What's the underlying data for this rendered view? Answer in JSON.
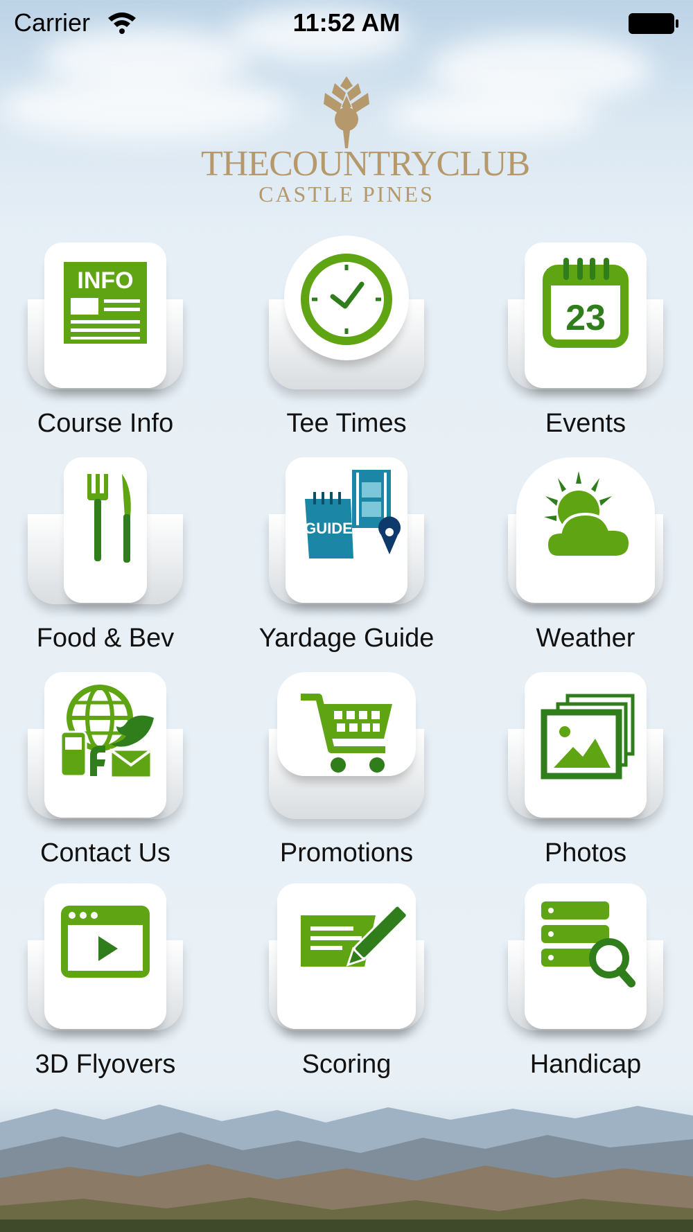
{
  "status_bar": {
    "carrier": "Carrier",
    "time": "11:52 AM"
  },
  "logo": {
    "title": "THECOUNTRYCLUB",
    "subtitle": "CASTLE PINES"
  },
  "colors": {
    "accent_green": "#5ea413",
    "dark_green": "#2f7d1b",
    "gold": "#b5996c",
    "guide_blue": "#1b86a6"
  },
  "tiles": [
    {
      "label": "Course Info",
      "icon": "info-newspaper-icon"
    },
    {
      "label": "Tee Times",
      "icon": "clock-icon"
    },
    {
      "label": "Events",
      "icon": "calendar-icon",
      "calendar_day": "23"
    },
    {
      "label": "Food & Bev",
      "icon": "fork-knife-icon"
    },
    {
      "label": "Yardage Guide",
      "icon": "guide-map-icon",
      "guide_text": "GUIDE"
    },
    {
      "label": "Weather",
      "icon": "sun-cloud-icon"
    },
    {
      "label": "Contact Us",
      "icon": "social-contact-icon"
    },
    {
      "label": "Promotions",
      "icon": "shopping-cart-icon"
    },
    {
      "label": "Photos",
      "icon": "photos-icon"
    },
    {
      "label": "3D Flyovers",
      "icon": "video-player-icon"
    },
    {
      "label": "Scoring",
      "icon": "scorecard-pencil-icon"
    },
    {
      "label": "Handicap",
      "icon": "database-search-icon"
    }
  ]
}
